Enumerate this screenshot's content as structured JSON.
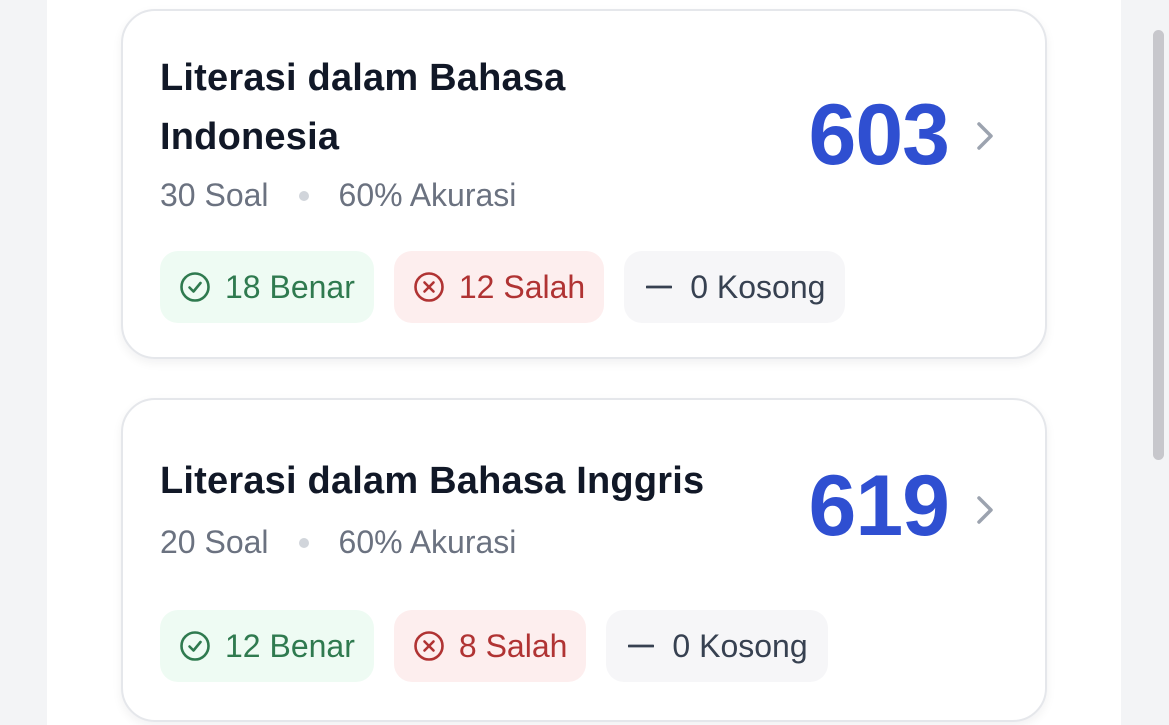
{
  "colors": {
    "score": "#2f4fd1",
    "correct": "#2f7a4f",
    "wrong": "#b03333",
    "title": "#111827",
    "meta": "#6b7280"
  },
  "cards": [
    {
      "title": "Literasi dalam Bahasa Indonesia",
      "questions": "30 Soal",
      "accuracy": "60% Akurasi",
      "score": "603",
      "correct": "18 Benar",
      "wrong": "12 Salah",
      "empty": "0 Kosong"
    },
    {
      "title": "Literasi dalam Bahasa Inggris",
      "questions": "20 Soal",
      "accuracy": "60% Akurasi",
      "score": "619",
      "correct": "12 Benar",
      "wrong": "8 Salah",
      "empty": "0 Kosong"
    }
  ],
  "icons": {
    "correct": "check-circle-icon",
    "wrong": "x-circle-icon",
    "empty": "minus-icon",
    "chevron": "chevron-right-icon"
  }
}
